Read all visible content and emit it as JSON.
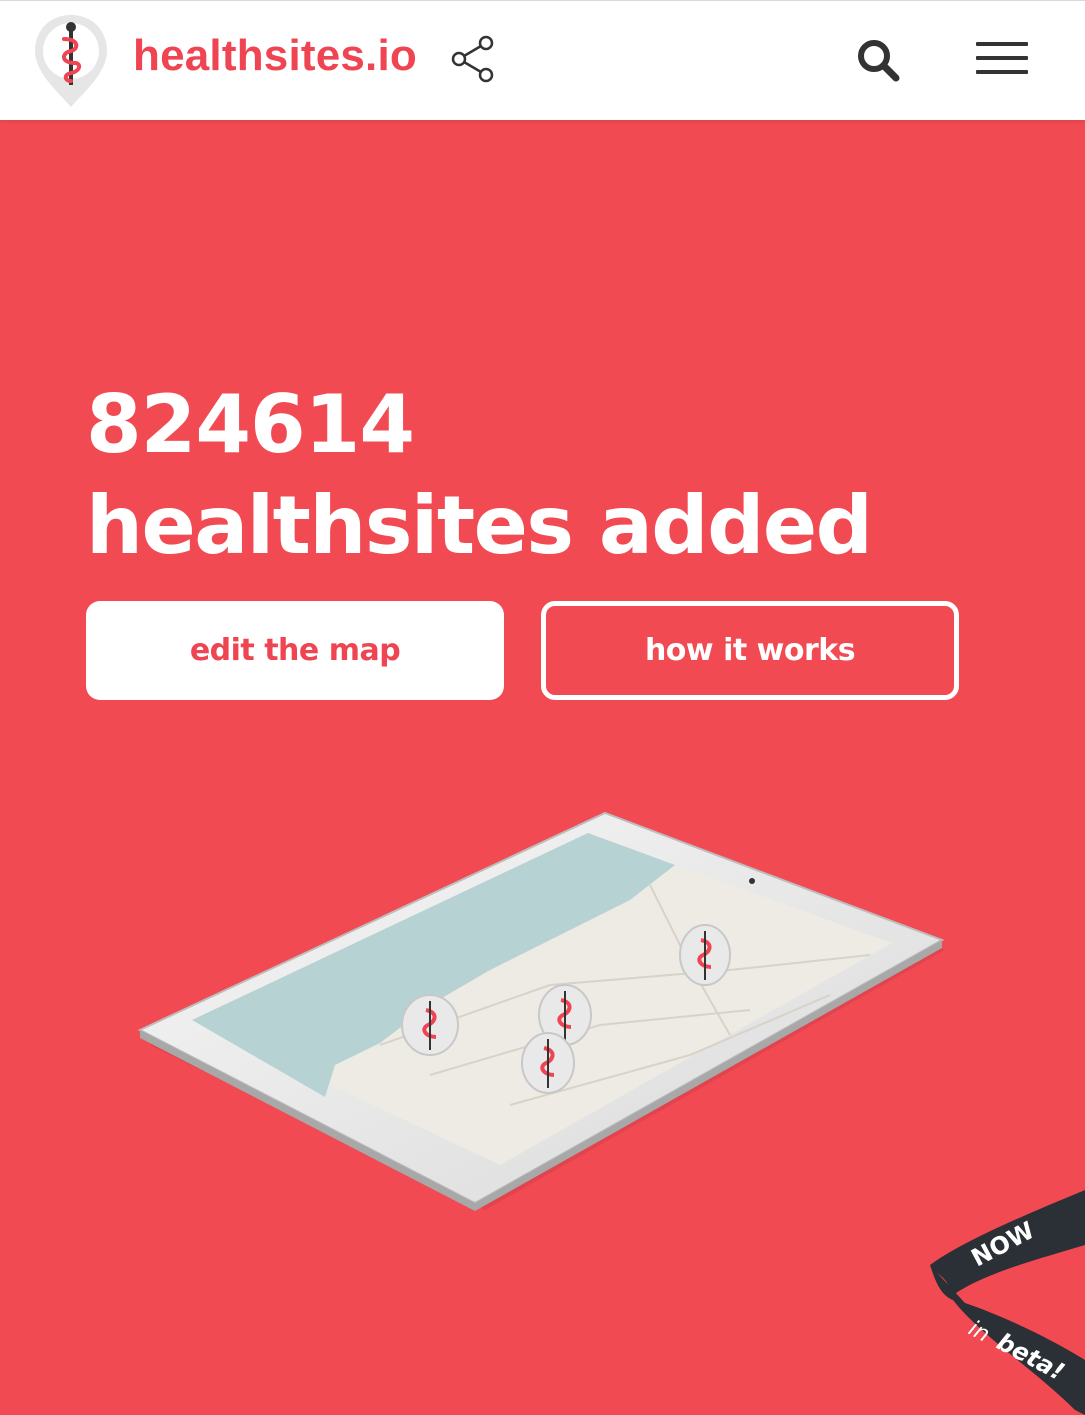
{
  "header": {
    "brand": "healthsites.io",
    "icons": [
      "caduceus-pin-logo-icon",
      "share-icon",
      "search-icon",
      "hamburger-menu-icon"
    ]
  },
  "hero": {
    "count": "824614",
    "subtitle": "healthsites added",
    "buttons": {
      "edit": "edit the map",
      "how": "how it works"
    }
  },
  "ribbon": {
    "line1": "NOW",
    "line2_prefix": "in",
    "line2_word": "beta!"
  },
  "colors": {
    "brand_red": "#ef4451",
    "hero_bg": "#f24a53",
    "white": "#ffffff",
    "dark": "#333333",
    "ribbon": "#2b2f36"
  }
}
